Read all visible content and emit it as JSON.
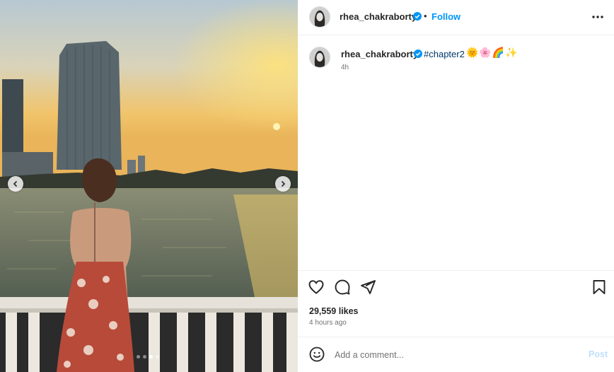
{
  "media": {
    "carousel_total": 4,
    "carousel_active_index": 2,
    "prev_icon": "chevron-left-icon",
    "next_icon": "chevron-right-icon"
  },
  "header": {
    "username": "rhea_chakraborty",
    "separator": "•",
    "follow_label": "Follow",
    "more_icon": "more-horizontal-icon"
  },
  "caption": {
    "username": "rhea_chakraborty",
    "hashtag": "#chapter2",
    "emojis": "🌞🌸🌈✨",
    "time": "4h"
  },
  "actions": {
    "likes": "29,559 likes",
    "time_ago": "4 hours ago",
    "icons": [
      "heart-icon",
      "comment-icon",
      "share-icon",
      "bookmark-icon"
    ]
  },
  "comment_bar": {
    "placeholder": "Add a comment...",
    "post_label": "Post"
  },
  "colors": {
    "link_blue": "#0095f6",
    "hashtag": "#00376b",
    "post_disabled": "#c0dffd",
    "verified": "#0095f6"
  }
}
